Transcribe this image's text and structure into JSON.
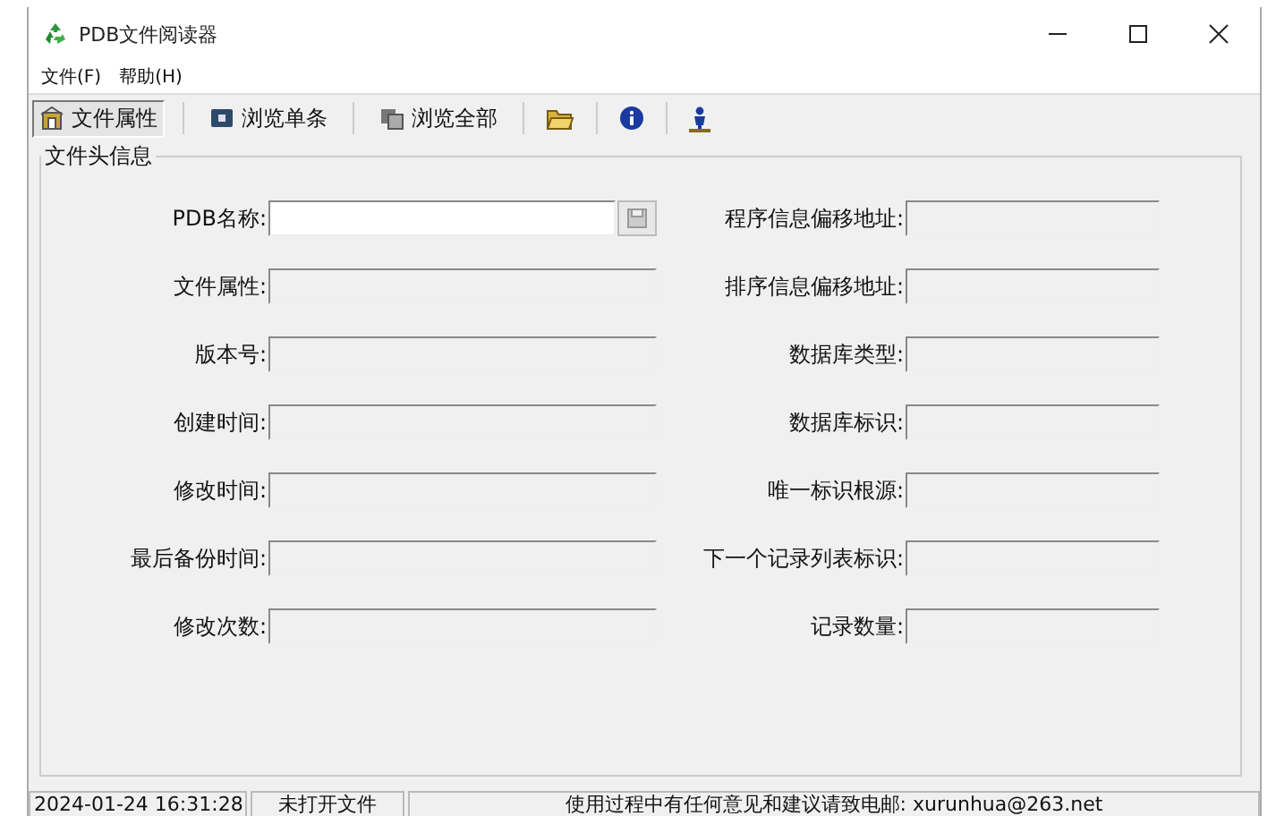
{
  "window": {
    "title": "PDB文件阅读器"
  },
  "menu": [
    {
      "label": "文件(F)"
    },
    {
      "label": "帮助(H)"
    }
  ],
  "toolbar": [
    {
      "kind": "tab",
      "label": "文件属性",
      "selected": true
    },
    {
      "kind": "tab",
      "label": "浏览单条",
      "selected": false
    },
    {
      "kind": "tab",
      "label": "浏览全部",
      "selected": false
    }
  ],
  "group": {
    "title": "文件头信息",
    "left": [
      {
        "kind": "with_button",
        "label": "PDB名称:",
        "disabled": false
      },
      {
        "label": "文件属性:",
        "disabled": true
      },
      {
        "label": "版本号:",
        "disabled": true
      },
      {
        "label": "创建时间:",
        "disabled": true
      },
      {
        "label": "修改时间:",
        "disabled": true
      },
      {
        "label": "最后备份时间:",
        "disabled": true
      },
      {
        "label": "修改次数:",
        "disabled": true
      }
    ],
    "right": [
      {
        "label": "程序信息偏移地址:",
        "disabled": true
      },
      {
        "label": "排序信息偏移地址:",
        "disabled": true
      },
      {
        "label": "数据库类型:",
        "disabled": true
      },
      {
        "label": "数据库标识:",
        "disabled": true
      },
      {
        "label": "唯一标识根源:",
        "disabled": true
      },
      {
        "label": "下一个记录列表标识:",
        "disabled": true
      },
      {
        "label": "记录数量:",
        "disabled": true
      }
    ]
  },
  "status_bar": [
    "2024-01-24 16:31:28",
    "未打开文件",
    "使用过程中有任何意见和建议请致电邮: xurunhua@263.net"
  ]
}
